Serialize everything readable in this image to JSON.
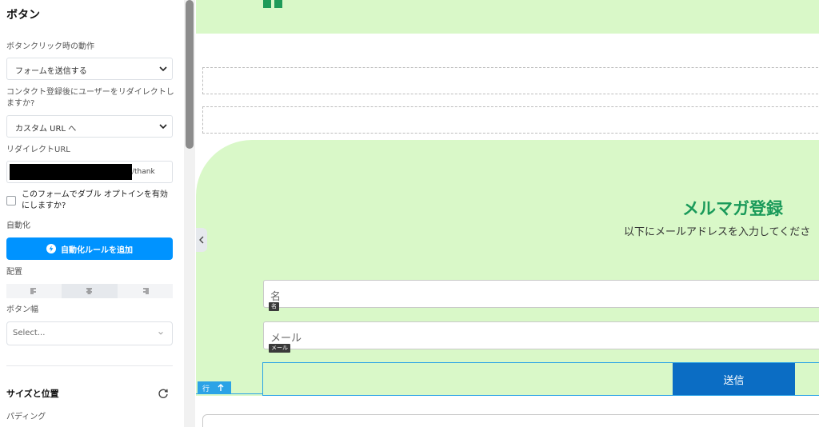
{
  "panel": {
    "title": "ボタン",
    "click_action_label": "ボタンクリック時の動作",
    "click_action_value": "フォームを送信する",
    "redirect_question": "コンタクト登録後にユーザーをリダイレクトしますか?",
    "redirect_value": "カスタム URL へ",
    "redirect_url_label": "リダイレクトURL",
    "redirect_url_suffix": "/thank",
    "double_optin_label": "このフォームでダブル オプトインを有効にしますか?",
    "automation_label": "自動化",
    "automation_button": "自動化ルールを追加",
    "alignment_label": "配置",
    "alignment_selected": "center",
    "button_width_label": "ボタン幅",
    "button_width_placeholder": "Select...",
    "size_position_title": "サイズと位置",
    "padding_label": "パディング"
  },
  "canvas": {
    "hero_title": "メルマガ登録",
    "hero_subtitle": "以下にメールアドレスを入力してくださ",
    "name_placeholder": "名",
    "name_tag": "名",
    "email_placeholder": "メール",
    "email_tag": "メール",
    "submit_label": "送信",
    "row_label": "行"
  },
  "colors": {
    "accent": "#0093ff",
    "submit": "#0b6dc4",
    "hero_bg": "#d9f8c8",
    "hero_title": "#1a9a5a",
    "selection": "#2ba3e6"
  }
}
